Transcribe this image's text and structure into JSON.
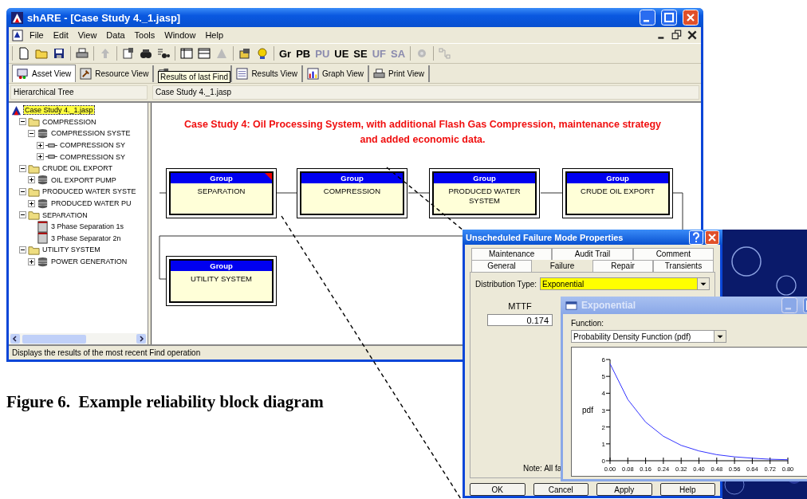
{
  "main_window": {
    "title": "shARE - [Case Study 4._1.jasp]",
    "menu": [
      "File",
      "Edit",
      "View",
      "Data",
      "Tools",
      "Window",
      "Help"
    ],
    "toolbar_text_buttons": [
      {
        "label": "Gr",
        "disabled": false
      },
      {
        "label": "PB",
        "disabled": false
      },
      {
        "label": "PU",
        "disabled": true
      },
      {
        "label": "UE",
        "disabled": false
      },
      {
        "label": "SE",
        "disabled": false
      },
      {
        "label": "UF",
        "disabled": true
      },
      {
        "label": "SA",
        "disabled": true
      }
    ],
    "view_tabs": [
      {
        "label": "Asset View",
        "selected": true
      },
      {
        "label": "Resource View",
        "selected": false
      },
      {
        "selected": false
      },
      {
        "label": "Results View",
        "selected": false
      },
      {
        "label": "Graph View",
        "selected": false
      },
      {
        "label": "Print View",
        "selected": false
      }
    ],
    "tooltip": "Results of last Find",
    "pane_headers": [
      "Hierarchical Tree",
      "Case Study 4._1.jasp"
    ],
    "tree": [
      {
        "label": "Case Study 4._1.jasp",
        "kind": "root",
        "selected": true,
        "children": [
          {
            "label": "COMPRESSION",
            "kind": "folder",
            "selected": false,
            "expanded": true,
            "children": [
              {
                "label": "COMPRESSION SYSTE",
                "kind": "group",
                "selected": false,
                "expanded": true,
                "children": [
                  {
                    "label": "COMPRESSION SY",
                    "kind": "block",
                    "selected": false,
                    "expanded": false
                  },
                  {
                    "label": "COMPRESSION SY",
                    "kind": "block",
                    "selected": false,
                    "expanded": false
                  }
                ]
              }
            ]
          },
          {
            "label": "CRUDE OIL EXPORT",
            "kind": "folder",
            "selected": false,
            "expanded": true,
            "children": [
              {
                "label": "OIL EXPORT PUMP",
                "kind": "group",
                "selected": false,
                "expanded": false
              }
            ]
          },
          {
            "label": "PRODUCED WATER SYSTE",
            "kind": "folder",
            "selected": false,
            "expanded": true,
            "children": [
              {
                "label": "PRODUCED WATER PU",
                "kind": "group",
                "selected": false,
                "expanded": false
              }
            ]
          },
          {
            "label": "SEPARATION",
            "kind": "folder",
            "selected": false,
            "expanded": true,
            "children": [
              {
                "label": "3 Phase Separation 1s",
                "kind": "item",
                "selected": false
              },
              {
                "label": "3 Phase Separator 2n",
                "kind": "item",
                "selected": false
              }
            ]
          },
          {
            "label": "UTILITY SYSTEM",
            "kind": "folder",
            "selected": false,
            "expanded": true,
            "children": [
              {
                "label": "POWER GENERATION",
                "kind": "group",
                "selected": false,
                "expanded": false
              }
            ]
          }
        ]
      }
    ],
    "diagram": {
      "title": "Case Study 4: Oil Processing System, with additional Flash Gas Compression, maintenance strategy and added economic data.",
      "blocks": [
        {
          "header": "Group",
          "label": "SEPARATION",
          "flagged": true
        },
        {
          "header": "Group",
          "label": "COMPRESSION",
          "flagged": false
        },
        {
          "header": "Group",
          "label": "PRODUCED WATER SYSTEM",
          "flagged": false
        },
        {
          "header": "Group",
          "label": "CRUDE OIL EXPORT",
          "flagged": false
        },
        {
          "header": "Group",
          "label": "UTILITY SYSTEM",
          "flagged": false
        }
      ]
    },
    "status_bar": "Displays the results of the most recent Find operation"
  },
  "properties_dialog": {
    "title": "Unscheduled Failure Mode Properties",
    "tabs_back": [
      {
        "label": "Maintenance",
        "selected": false
      },
      {
        "label": "Audit Trail",
        "selected": false
      },
      {
        "label": "Comment",
        "selected": false
      }
    ],
    "tabs_front": [
      {
        "label": "General",
        "selected": false
      },
      {
        "label": "Failure",
        "selected": true
      },
      {
        "label": "Repair",
        "selected": false
      },
      {
        "label": "Transients",
        "selected": false
      }
    ],
    "distribution_label": "Distribution Type:",
    "distribution_value": "Exponential",
    "mttf_label": "MTTF",
    "mttf_value": "0.174",
    "note": "Note: All fa",
    "buttons": [
      "OK",
      "Cancel",
      "Apply",
      "Help"
    ]
  },
  "exponential_window": {
    "title": "Exponential",
    "function_label": "Function:",
    "function_value": "Probability Density Function (pdf)",
    "chart_data": {
      "type": "line",
      "ylabel": "pdf",
      "x": [
        0,
        0.08,
        0.16,
        0.24,
        0.32,
        0.4,
        0.48,
        0.56,
        0.64,
        0.72,
        0.8
      ],
      "series": [
        {
          "color": "#3333ff",
          "values": [
            5.75,
            3.63,
            2.29,
            1.45,
            0.91,
            0.58,
            0.36,
            0.23,
            0.15,
            0.09,
            0.06
          ]
        }
      ],
      "xlim": [
        0,
        0.8
      ],
      "ylim": [
        0,
        6
      ],
      "xticks": [
        {
          "value": 0,
          "label": "0.00"
        },
        {
          "value": 0.08,
          "label": "0.08"
        },
        {
          "value": 0.16,
          "label": "0.16"
        },
        {
          "value": 0.24,
          "label": "0.24"
        },
        {
          "value": 0.32,
          "label": "0.32"
        },
        {
          "value": 0.4,
          "label": "0.40"
        },
        {
          "value": 0.48,
          "label": "0.48"
        },
        {
          "value": 0.56,
          "label": "0.56"
        },
        {
          "value": 0.64,
          "label": "0.64"
        },
        {
          "value": 0.72,
          "label": "0.72"
        },
        {
          "value": 0.8,
          "label": "0.80"
        }
      ],
      "yticks": [
        0,
        1,
        2,
        3,
        4,
        5,
        6
      ]
    }
  },
  "caption": "Figure 6.  Example reliability block diagram"
}
